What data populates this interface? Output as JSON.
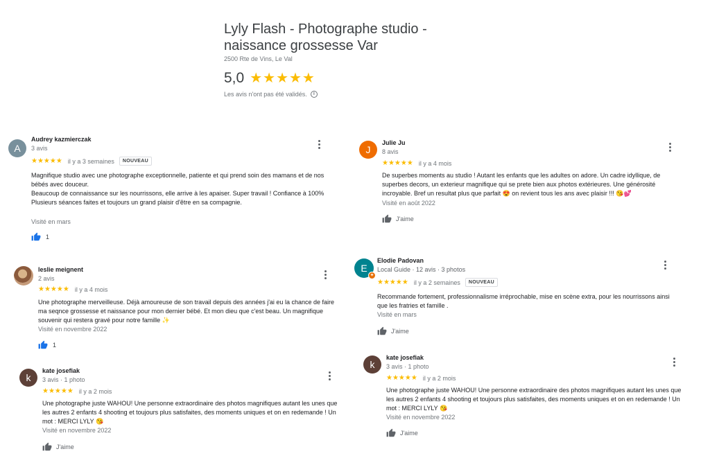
{
  "business": {
    "name": "Lyly Flash - Photographe studio - naissance grossesse Var",
    "address": "2500 Rte de Vins, Le Val",
    "rating": "5,0",
    "stars": "★★★★★",
    "disclaimer": "Les avis n'ont pas été validés."
  },
  "colors": {
    "star": "#fbbc04",
    "like_blue": "#1a73e8",
    "like_grey": "#5f6368"
  },
  "reviews": [
    {
      "author": "Audrey kazmierczak",
      "avatar_letter": "A",
      "avatar_color": "#78909c",
      "meta": "3 avis",
      "stars": "★★★★★",
      "time": "il y a 3 semaines",
      "badge": "NOUVEAU",
      "text": "Magnifique studio avec une photographe exceptionnelle, patiente et qui prend soin des mamans et de nos bébés avec douceur.\nBeaucoup de connaissance sur les nourrissons, elle arrive à les apaiser. Super travail ! Confiance à 100%\nPlusieurs séances faites et toujours un grand plaisir d'être en sa compagnie.",
      "visited": "Visité en mars",
      "like_count": "1"
    },
    {
      "author": "leslie meignent",
      "meta": "2 avis",
      "stars": "★★★★★",
      "time": "il y a 4 mois",
      "text": "Une photographe merveilleuse. Déjà amoureuse de son travail depuis des années j'ai eu la chance de faire ma seqnce grossesse et naissance pour mon dernier bébé. Et mon dieu que c'est beau. Un magnifique souvenir qui restera gravé pour notre famille ✨",
      "visited": "Visité en novembre 2022",
      "like_count": "1"
    },
    {
      "author": "kate josefiak",
      "avatar_letter": "k",
      "avatar_color": "#5d4037",
      "meta": "3 avis · 1 photo",
      "stars": "★★★★★",
      "time": "il y a 2 mois",
      "text": "Une photographe juste WAHOU! Une personne extraordinaire des photos magnifiques autant les unes que les autres 2 enfants 4 shooting et toujours plus satisfaites, des moments uniques et on en redemande ! Un mot : MERCI LYLY 😘",
      "visited": "Visité en novembre 2022",
      "like_label": "J'aime"
    },
    {
      "author": "Julie Ju",
      "avatar_letter": "J",
      "avatar_color": "#ef6c00",
      "meta": "8 avis",
      "stars": "★★★★★",
      "time": "il y a 4 mois",
      "text": "De superbes moments au studio ! Autant les enfants que les adultes on adore. Un cadre idyllique, de superbes decors, un exterieur magnifique qui se prete bien aux photos extérieures. Une générosité incroyable. Bref un resultat plus que parfait 😍 on revient tous les ans avec plaisir !!! 😘💕",
      "visited": "Visité en août 2022",
      "like_label": "J'aime"
    },
    {
      "author": "Elodie Padovan",
      "avatar_letter": "E",
      "avatar_color": "#00838f",
      "meta": "Local Guide · 12 avis · 3 photos",
      "stars": "★★★★★",
      "time": "il y a 2 semaines",
      "badge": "NOUVEAU",
      "text": "Recommande fortement, professionnalisme irréprochable, mise en scène extra, pour les nourrissons ainsi que les fratries et famille .",
      "visited": "Visité en mars",
      "like_label": "J'aime"
    },
    {
      "author": "kate josefiak",
      "avatar_letter": "k",
      "avatar_color": "#5d4037",
      "meta": "3 avis · 1 photo",
      "stars": "★★★★★",
      "time": "il y a 2 mois",
      "text": "Une photographe juste WAHOU! Une personne extraordinaire des photos magnifiques autant les unes que les autres 2 enfants 4 shooting et toujours plus satisfaites, des moments uniques et on en redemande ! Un mot : MERCI LYLY 😘",
      "visited": "Visité en novembre 2022",
      "like_label": "J'aime"
    }
  ]
}
